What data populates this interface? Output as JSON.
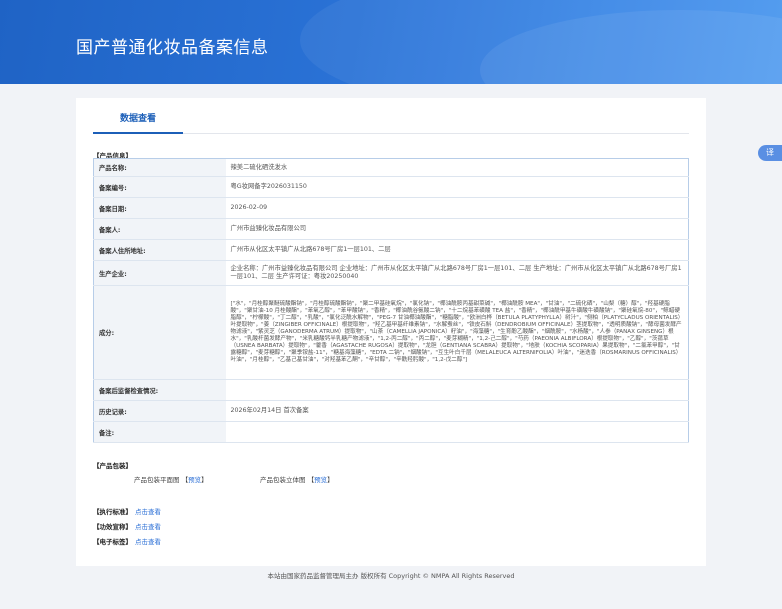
{
  "header": {
    "title": "国产普通化妆品备案信息"
  },
  "tabs": [
    {
      "label": "数据查看"
    }
  ],
  "product_info": {
    "section_title": "【产品信息】",
    "rows": [
      {
        "key": "产品名称:",
        "value": "辣美二硫化硒洗发水"
      },
      {
        "key": "备案编号:",
        "value": "粤G妆网备字2026031150"
      },
      {
        "key": "备案日期:",
        "value": "2026-02-09"
      },
      {
        "key": "备案人:",
        "value": "广州市益臻化妆品有限公司"
      },
      {
        "key": "备案人住所地址:",
        "value": "广州市从化区太平镇广从北路678号厂房1一层101、二层"
      },
      {
        "key": "生产企业:",
        "value": "企业名称：广州市益臻化妆品有限公司 企业地址：广州市从化区太平镇广从北路678号厂房1一层101、二层 生产地址：广州市从化区太平镇广从北路678号厂房1一层101、二层 生产许可证：粤妆20250040"
      },
      {
        "key": "成分:",
        "value": "[\"水\"，\"月桂醇聚醚硫酸酯钠\"，\"月桂醇硫酸酯钠\"，\"聚二甲基硅氧烷\"，\"氯化钠\"，\"椰油酰胺丙基甜菜碱\"，\"椰油酰胺 MEA\"，\"甘油\"，\"二硫化硒\"，\"山梨（糖）醇\"，\"羟基硬脂酸\"，\"聚甘油-10 月桂酸酯\"，\"苯氧乙醇\"，\"苯甲酸钠\"，\"香精\"，\"椰油酰谷氨酸二钠\"，\"十二烷基苯磺酸 TEA 盐\"，\"香精\"，\"椰油酰甲基牛磺酸牛磺酸钠\"，\"聚硅氧烷-80\"，\"鲸蜡硬脂醇\"，\"柠檬酸\"，\"丁二醇\"，\"乳酸\"，\"氯化泛酰水解物\"，\"PEG-7 甘油椰油酸酯\"，\"糖脂酸\"，\"欧洲白桦（BETULA PLATYPHYLLA）树汁\"，\"侧柏（PLATYCLADUS ORIENTALIS）叶提取物\"，\"姜（ZINGIBER OFFICINALE）根提取物\"，\"羟乙基甲基纤维素钠\"，\"水解蚕丝\"，\"铁皮石斛（DENDROBIUM OFFICINALE）茎提取物\"，\"透明质酸钠\"，\"酵母菌发酵产物滤液\"，\"紫灵芝（GANODERMA ATRUM）提取物\"，\"山茶（CAMELLIA JAPONICA）籽油\"，\"海藻糖\"，\"生育酚乙酸酯\"，\"烟酰胺\"，\"水杨酸\"，\"人参（PANAX GINSENG）根水\"，\"乳酸杆菌发酵产物\"，\"米乳糖酸钙半乳糖产物滤液\"，\"1,2-丙二醇\"，\"丙二醇\"，\"麦芽糊精\"，\"1,2-己二醇\"，\"芍药（PAEONIA ALBIFLORA）根提取物\"，\"乙醇\"，\"茨菰草（USNEA BARBATA）提取物\"，\"藿香（AGASTACHE RUGOSA）提取物\"，\"龙胆（GENTIANA SCABRA）提取物\"，\"地肤（KOCHIA SCOPARIA）果提取物\"，\"二氯苯甲醇\"，\"甘露糖醇\"，\"麦芽糖醇\"，\"聚季铵盐-11\"，\"糖基海藻糖\"，\"EDTA 二钠\"，\"烟酸钠\"，\"互生叶白千层（MELALEUCA ALTERNIFOLIA）叶油\"，\"迷迭香（ROSMARINUS OFFICINALIS）叶油\"，\"月桂醇\"，\"乙基己基甘油\"，\"对羟基苯乙酮\"，\"辛甘醇\"，\"辛酰羟肟酸\"，\"1,2-戊二醇\"]"
      },
      {
        "key": "备案后监督检查情况:",
        "value": ""
      },
      {
        "key": "历史记录:",
        "value": "2026年02月14日 首次备案"
      },
      {
        "key": "备注:",
        "value": ""
      }
    ]
  },
  "packaging": {
    "section_title": "【产品包装】",
    "flat_label": "产品包装平面图",
    "stereo_label": "产品包装立体图",
    "preview_link": "预览"
  },
  "links": [
    {
      "label": "【执行标准】",
      "link": "点击查看"
    },
    {
      "label": "【功效宣称】",
      "link": "点击查看"
    },
    {
      "label": "【电子标签】",
      "link": "点击查看"
    }
  ],
  "footer": {
    "text": "本站由国家药品监督管理局主办 版权所有 Copyright © NMPA All Rights Reserved"
  },
  "float_button": {
    "label": "译"
  },
  "colors": {
    "banner": "#2a72d6",
    "accent": "#1c5fb8",
    "link": "#2b6fd6"
  }
}
